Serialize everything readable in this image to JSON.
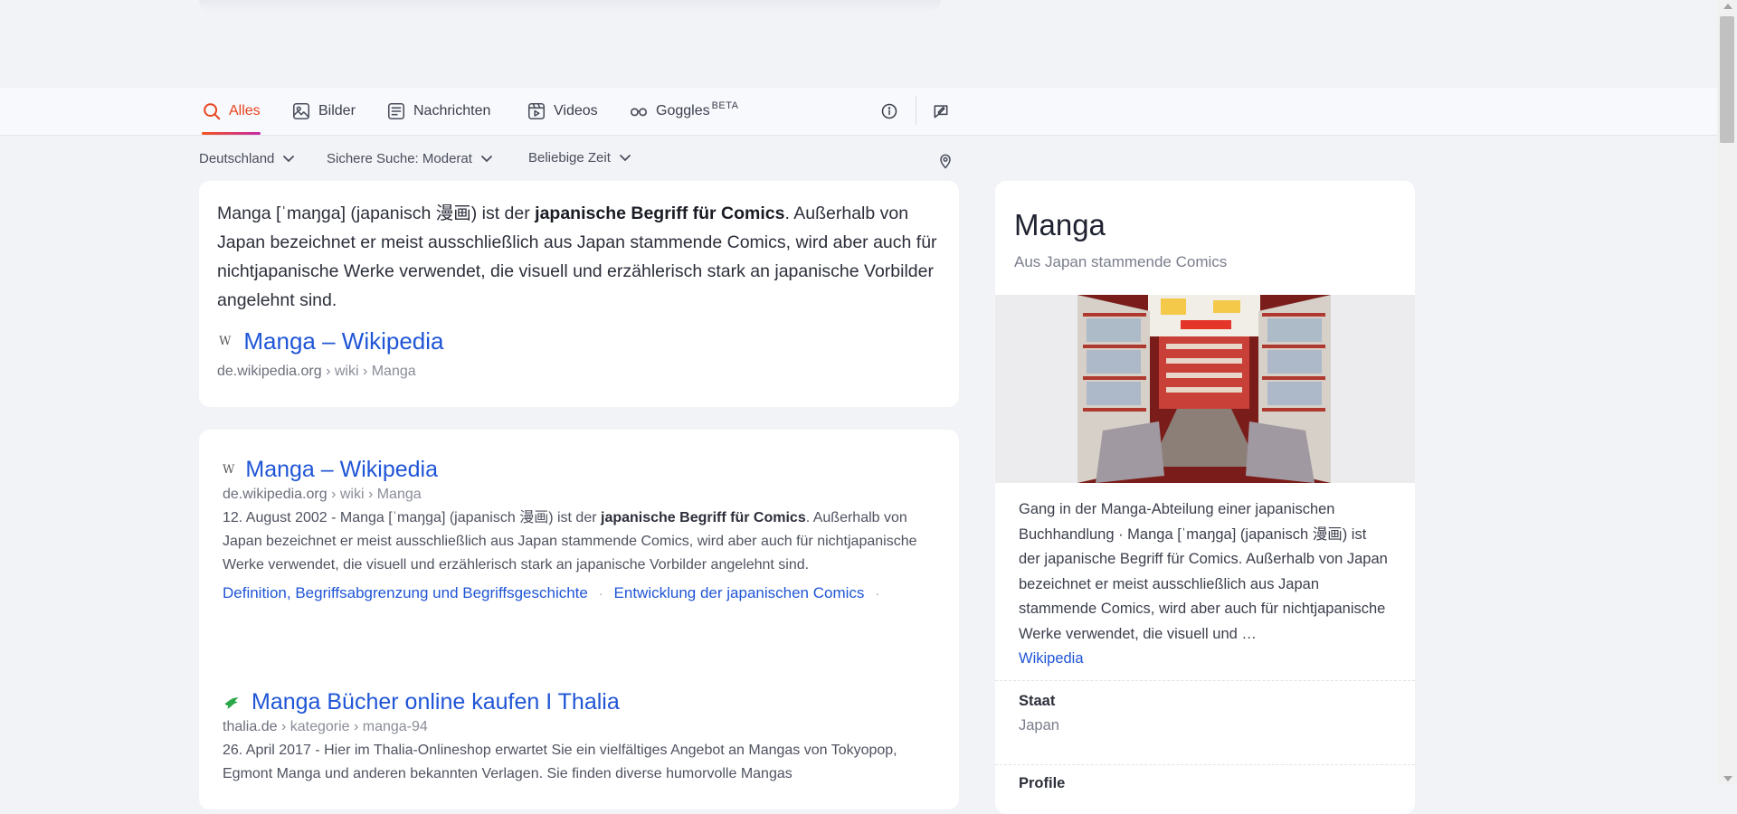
{
  "tabs": [
    {
      "label": "Alles",
      "icon": "search-icon",
      "active": true
    },
    {
      "label": "Bilder",
      "icon": "image-icon"
    },
    {
      "label": "Nachrichten",
      "icon": "news-icon"
    },
    {
      "label": "Videos",
      "icon": "video-icon"
    },
    {
      "label": "Goggles",
      "icon": "goggles-icon",
      "badge": "BETA"
    }
  ],
  "nav_icons": [
    "info-icon",
    "feedback-icon"
  ],
  "filters": {
    "region": "Deutschland",
    "safe_search": "Sichere Suche: Moderat",
    "time": "Beliebige Zeit",
    "location_icon": "location-pin-icon"
  },
  "snippet": {
    "pre": "Manga [ˈmaŋɡa] (japanisch 漫画) ist der ",
    "bold": "japanische Begriff für Comics",
    "post": ". Außerhalb von Japan bezeichnet er meist ausschließlich aus Japan stammende Comics, wird aber auch für nichtjapanische Werke verwendet, die visuell und erzählerisch stark an japanische Vorbilder angelehnt sind.",
    "favicon": "W",
    "source_title": "Manga – Wikipedia",
    "source_host": "de.wikipedia.org",
    "source_path": " › wiki › Manga"
  },
  "results": [
    {
      "favicon": "W",
      "title": "Manga – Wikipedia",
      "host": "de.wikipedia.org",
      "path": " › wiki › Manga",
      "date": "12. August 2002 - ",
      "desc_pre": "Manga [ˈmaŋɡa] (japanisch 漫画) ist der ",
      "desc_bold": "japanische Begriff für Comics",
      "desc_post": ". Außerhalb von Japan bezeichnet er meist ausschließlich aus Japan stammende Comics, wird aber auch für nichtjapanische Werke verwendet, die visuell und erzählerisch stark an japanische Vorbilder angelehnt sind.",
      "sublinks": [
        "Definition, Begriffsabgrenzung und Begriffsgeschichte",
        "Entwicklung der japanischen Comics"
      ],
      "separator": "·"
    },
    {
      "favicon": "thalia-bird-icon",
      "title": "Manga Bücher online kaufen I Thalia",
      "host": "thalia.de",
      "path": " › kategorie › manga-94",
      "date": "26. April 2017 - ",
      "desc": "Hier im Thalia-Onlineshop erwartet Sie ein vielfältiges Angebot an Mangas von Tokyopop, Egmont Manga und anderen bekannten Verlagen. Sie finden diverse humorvolle Mangas"
    }
  ],
  "knowledge_panel": {
    "title": "Manga",
    "subtitle": "Aus Japan stammende Comics",
    "description": "Gang in der Manga-Abteilung einer japanischen Buchhandlung · Manga [ˈmaŋɡa] (japanisch 漫画) ist der japanische Begriff für Comics. Außerhalb von Japan bezeichnet er meist ausschließlich aus Japan stammende Comics, wird aber auch für nichtjapanische Werke verwendet, die visuell und …",
    "source": "Wikipedia",
    "facts": [
      {
        "label": "Staat",
        "value": "Japan"
      },
      {
        "label": "Profile",
        "value": ""
      }
    ]
  },
  "colors": {
    "accent": "#e8441f",
    "link": "#1f55d6",
    "thalia_green": "#2aa84a"
  }
}
